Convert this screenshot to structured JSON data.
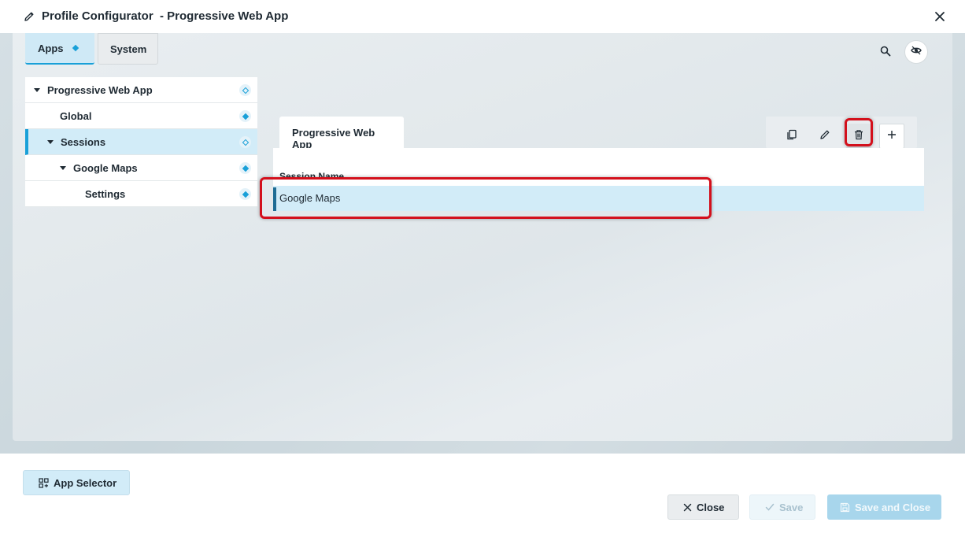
{
  "window": {
    "title": "Profile Configurator  - Progressive Web App"
  },
  "tabs": [
    {
      "label": "Apps",
      "selected": true
    },
    {
      "label": "System",
      "selected": false
    }
  ],
  "tree": {
    "items": [
      {
        "label": "Progressive Web App",
        "level": 0,
        "expanded": true,
        "selected": false,
        "badge": "outline-diamond"
      },
      {
        "label": "Global",
        "level": 1,
        "expanded": false,
        "selected": false,
        "badge": "filled-diamond"
      },
      {
        "label": "Sessions",
        "level": 1,
        "expanded": true,
        "selected": true,
        "badge": "outline-diamond"
      },
      {
        "label": "Google Maps",
        "level": 2,
        "expanded": true,
        "selected": false,
        "badge": "filled-diamond"
      },
      {
        "label": "Settings",
        "level": 3,
        "expanded": false,
        "selected": false,
        "badge": "filled-diamond"
      }
    ]
  },
  "content": {
    "tab_label": "Progressive Web App",
    "toolbar_icons": [
      "copy-icon",
      "pencil-icon",
      "trash-icon",
      "plus-icon"
    ],
    "grid": {
      "column_header": "Session Name",
      "rows": [
        "Google Maps"
      ]
    }
  },
  "footer": {
    "app_selector_label": "App Selector",
    "close_label": "Close",
    "save_label": "Save",
    "save_and_close_label": "Save and Close"
  },
  "colors": {
    "accent": "#19a0d8",
    "highlight": "#d3101c",
    "selection": "#d2ecf8"
  }
}
